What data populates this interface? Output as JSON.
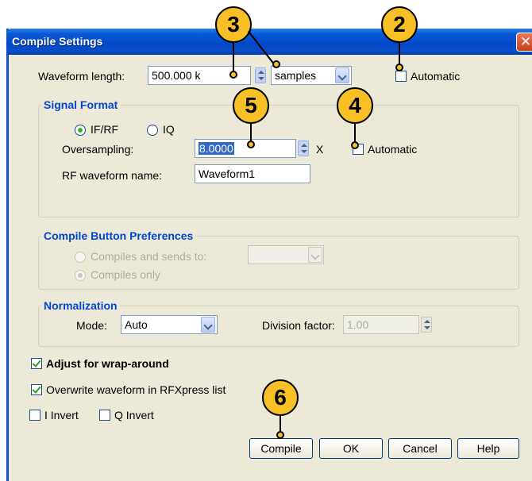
{
  "window": {
    "title": "Compile Settings",
    "close_icon": "close-icon"
  },
  "waveform_length": {
    "label": "Waveform length:",
    "value": "500.000 k",
    "unit": "samples",
    "automatic_label": "Automatic",
    "automatic_checked": false
  },
  "signal_format": {
    "title": "Signal Format",
    "radio_ifrf": "IF/RF",
    "radio_iq": "IQ",
    "selected": "IF/RF",
    "oversampling_label": "Oversampling:",
    "oversampling_value": "8.0000",
    "oversampling_unit": "X",
    "automatic_label": "Automatic",
    "automatic_checked": false,
    "rf_name_label": "RF waveform name:",
    "rf_name_value": "Waveform1"
  },
  "compile_prefs": {
    "title": "Compile Button Preferences",
    "option_send": "Compiles and sends to:",
    "option_only": "Compiles only",
    "selected": "Compiles only",
    "send_target": ""
  },
  "normalization": {
    "title": "Normalization",
    "mode_label": "Mode:",
    "mode_value": "Auto",
    "division_label": "Division factor:",
    "division_value": "1.00"
  },
  "options": {
    "wrap_label": "Adjust for wrap-around",
    "wrap_checked": true,
    "overwrite_label": "Overwrite waveform in RFXpress list",
    "overwrite_checked": true,
    "i_invert_label": "I Invert",
    "i_invert_checked": false,
    "q_invert_label": "Q Invert",
    "q_invert_checked": false
  },
  "buttons": {
    "compile": "Compile",
    "ok": "OK",
    "cancel": "Cancel",
    "help": "Help"
  },
  "callouts": {
    "c2": "2",
    "c3": "3",
    "c4": "4",
    "c5": "5",
    "c6": "6"
  },
  "colors": {
    "callout_fill": "#f6c026",
    "title_bar": "#0a5ad6",
    "group_title": "#0046d5"
  }
}
